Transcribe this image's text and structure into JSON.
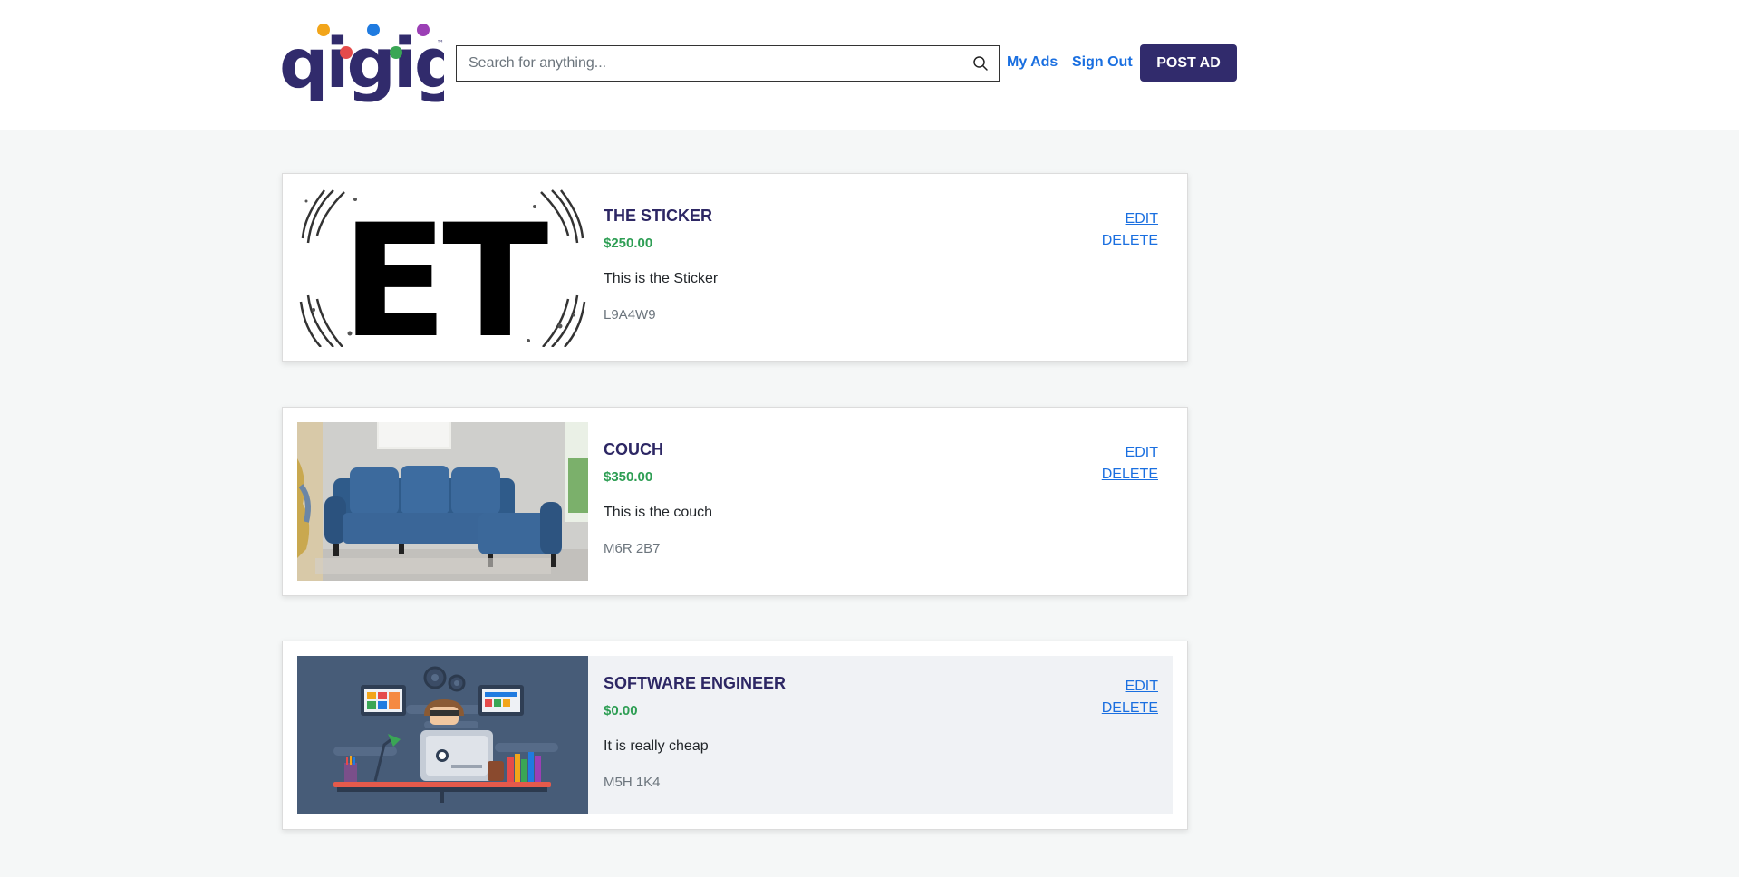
{
  "brand": {
    "logo_text": "qigigi",
    "logo_dot_colors": [
      "#f2a51a",
      "#e54b4b",
      "#1f7be0",
      "#3aa655",
      "#9b3fb5"
    ],
    "logo_color": "#312b6c"
  },
  "header": {
    "search_placeholder": "Search for anything...",
    "search_icon": "search-icon",
    "links": {
      "my_ads": "My Ads",
      "sign_out": "Sign Out"
    },
    "post_ad_label": "POST AD"
  },
  "colors": {
    "accent": "#312b6c",
    "link": "#1a6fe0",
    "price": "#2e9e54",
    "page_bg": "#f5f7f7"
  },
  "ads": [
    {
      "title": "THE STICKER",
      "price": "$250.00",
      "description": "This is the Sticker",
      "postal_code": "L9A4W9",
      "edit_label": "EDIT",
      "delete_label": "DELETE",
      "image": "et-sticker-image",
      "image_text": "ET"
    },
    {
      "title": "COUCH",
      "price": "$350.00",
      "description": "This is the couch",
      "postal_code": "M6R 2B7",
      "edit_label": "EDIT",
      "delete_label": "DELETE",
      "image": "blue-couch-image"
    },
    {
      "title": "SOFTWARE ENGINEER",
      "price": "$0.00",
      "description": "It is really cheap",
      "postal_code": "M5H 1K4",
      "edit_label": "EDIT",
      "delete_label": "DELETE",
      "image": "software-engineer-illustration"
    }
  ]
}
